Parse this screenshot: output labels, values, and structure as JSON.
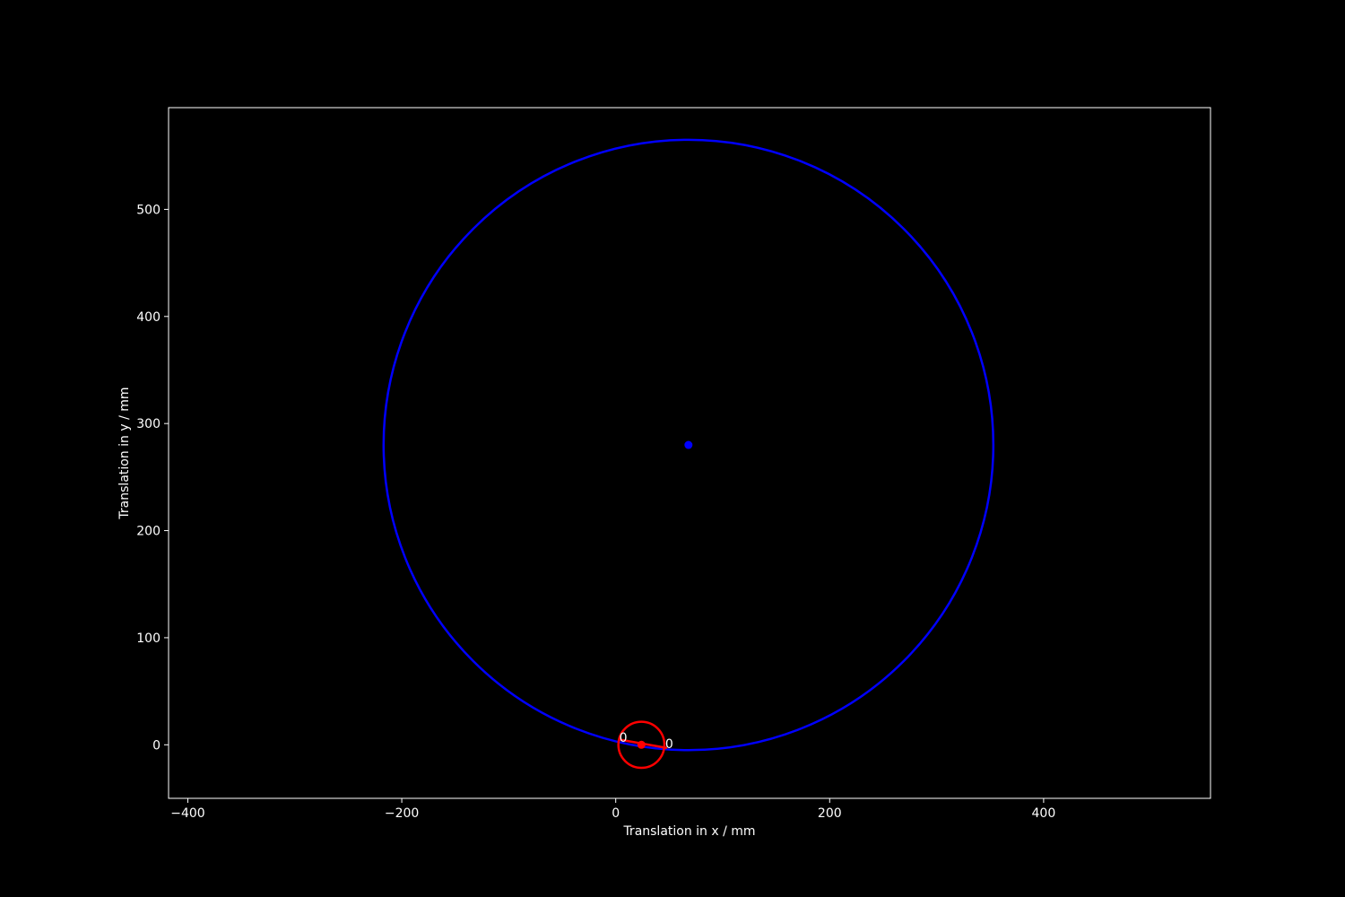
{
  "chart_data": {
    "type": "scatter",
    "title": "",
    "xlabel": "Translation in x / mm",
    "ylabel": "Translation in y / mm",
    "xlim": [
      -418,
      556
    ],
    "ylim": [
      -50,
      595
    ],
    "grid": false,
    "legend": "none",
    "x_ticks": [
      -400,
      -200,
      0,
      200,
      400
    ],
    "y_ticks": [
      0,
      100,
      200,
      300,
      400,
      500
    ],
    "colors": {
      "background": "#000000",
      "axes": "#ffffff",
      "large_circle": "#0000ff",
      "small_circle": "#ff0000"
    },
    "circles": [
      {
        "name": "large",
        "center": [
          68,
          280
        ],
        "radius": 285,
        "color": "#0000ff"
      },
      {
        "name": "small",
        "center": [
          24,
          0
        ],
        "radius": 21.5,
        "color": "#ff0000"
      }
    ],
    "points": [
      {
        "name": "large-center",
        "x": 68,
        "y": 280,
        "color": "#0000ff"
      },
      {
        "name": "small-center",
        "x": 24,
        "y": 0,
        "color": "#ff0000"
      }
    ],
    "segments": [
      {
        "name": "small-radius-line",
        "x": [
          3,
          48
        ],
        "y": [
          5,
          -3
        ],
        "color": "#ff0000"
      }
    ],
    "annotations": [
      {
        "text": "0",
        "x": 7,
        "y": 7
      },
      {
        "text": "0",
        "x": 50,
        "y": 1
      }
    ]
  }
}
